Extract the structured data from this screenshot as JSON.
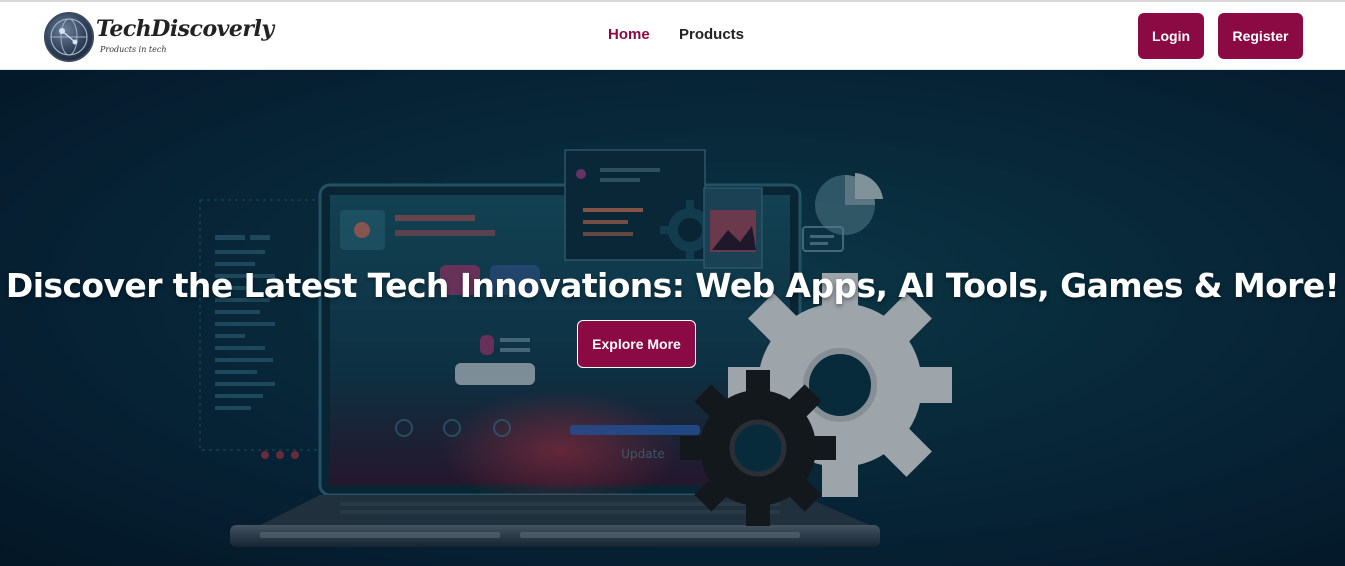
{
  "brand": {
    "name": "TechDiscoverly",
    "tagline": "Products in tech"
  },
  "nav": {
    "items": [
      {
        "label": "Home",
        "active": true
      },
      {
        "label": "Products",
        "active": false
      }
    ]
  },
  "auth": {
    "login_label": "Login",
    "register_label": "Register"
  },
  "hero": {
    "title": "Discover the Latest Tech Innovations: Web Apps, AI Tools, Games & More!",
    "cta_label": "Explore More",
    "illustration_text": "Update"
  },
  "colors": {
    "accent": "#8b0a44",
    "hero_bg": "#0b3446",
    "nav_text": "#222222"
  },
  "icons": [
    "logo-globe-icon",
    "laptop-illustration",
    "gear-icon",
    "pie-chart-icon",
    "image-icon"
  ]
}
